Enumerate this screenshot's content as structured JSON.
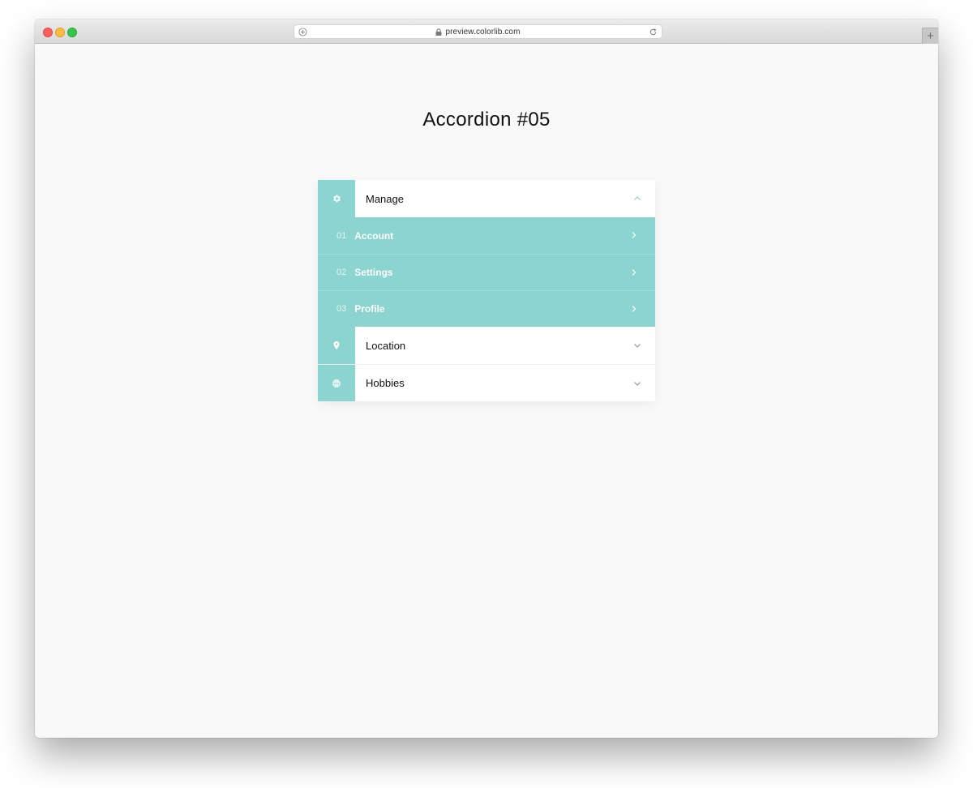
{
  "browser": {
    "url": "preview.colorlib.com",
    "new_tab_label": "+"
  },
  "page": {
    "title": "Accordion #05"
  },
  "accordion": {
    "accent_color": "#8cd4cf",
    "sections": [
      {
        "label": "Manage",
        "icon": "gear-icon",
        "expanded": true,
        "items": [
          {
            "number": "01",
            "label": "Account"
          },
          {
            "number": "02",
            "label": "Settings"
          },
          {
            "number": "03",
            "label": "Profile"
          }
        ]
      },
      {
        "label": "Location",
        "icon": "map-pin-icon",
        "expanded": false
      },
      {
        "label": "Hobbies",
        "icon": "basketball-icon",
        "expanded": false
      }
    ]
  }
}
